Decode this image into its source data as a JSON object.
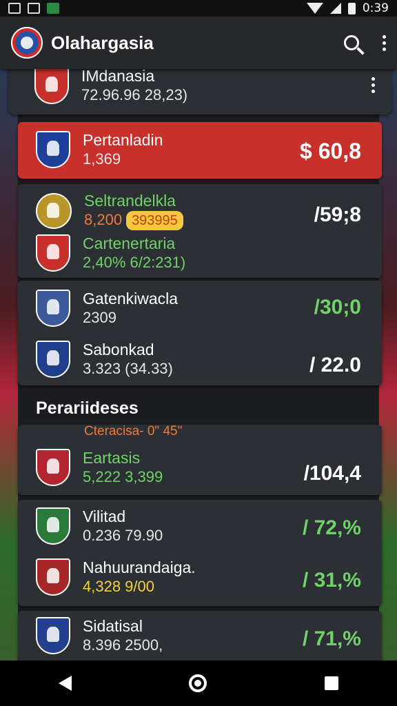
{
  "statusbar": {
    "time": "0:39"
  },
  "appbar": {
    "title": "Olahargasia"
  },
  "top_card": {
    "name": "IMdanasia",
    "sub": "72.96.96 28,23)",
    "crest_color": "#c7302b"
  },
  "highlight": {
    "name": "Pertanladin",
    "sub": "1,369",
    "value": "$ 60,8",
    "crest_color": "#1e3f9a"
  },
  "group1": {
    "items": [
      {
        "name": "Seltrandelkla",
        "sub": "8,200",
        "badge": "393995",
        "crest_color": "#b8962a"
      },
      {
        "name": "Cartenertaria",
        "sub": "2,40%  6/2:231)",
        "crest_color": "#c7302b"
      }
    ],
    "value": "/59;8"
  },
  "group2": {
    "items": [
      {
        "name": "Gatenkiwacla",
        "sub": "2309",
        "value": "/30;0",
        "crest_color": "#3a5a9a"
      },
      {
        "name": "Sabonkad",
        "sub": "3.323  (34.33)",
        "value": "/ 22.0",
        "crest_color": "#1f3f8a"
      }
    ]
  },
  "section": {
    "title": "Perariideses",
    "peek": "Cteracisa- 0\" 45\""
  },
  "list": [
    {
      "name": "Eartasis",
      "sub": "5,222  3,399",
      "value": "/104,4",
      "crest_color": "#b3262f"
    },
    {
      "name": "Vilitad",
      "sub": "0.236  79.90",
      "value": "/ 72,%",
      "crest_color": "#2a7a3c"
    },
    {
      "name": "Nahuurandaiga.",
      "sub": "4,328  9/00",
      "value": "/ 31,%",
      "crest_color": "#a8282a"
    },
    {
      "name": "Sidatisal",
      "sub": "8.396  2500,",
      "value": "/ 71,%",
      "crest_color": "#233f8f"
    }
  ],
  "colors": {
    "accent_green": "#6fd36a",
    "highlight_red": "#c7302b",
    "card_bg": "#2c2f33"
  },
  "icons": [
    "search-icon",
    "overflow-menu-icon",
    "back-icon",
    "home-icon",
    "recents-icon"
  ]
}
